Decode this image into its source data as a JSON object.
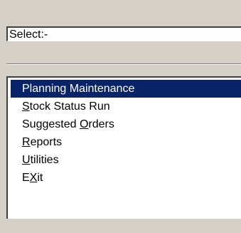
{
  "select_field": {
    "value": "Select:-"
  },
  "menu": {
    "selected_index": 0,
    "items": [
      {
        "label": "Planning Maintenance",
        "mnemonic_index": -1
      },
      {
        "label": "Stock Status Run",
        "mnemonic_index": 0
      },
      {
        "label": "Suggested Orders",
        "mnemonic_index": 10
      },
      {
        "label": "Reports",
        "mnemonic_index": 0
      },
      {
        "label": "Utilities",
        "mnemonic_index": 0
      },
      {
        "label": "EXit",
        "mnemonic_index": 1
      }
    ]
  },
  "colors": {
    "window_background": "#d4d0c8",
    "selection_background": "#0a246a",
    "selection_text": "#ffffff"
  }
}
